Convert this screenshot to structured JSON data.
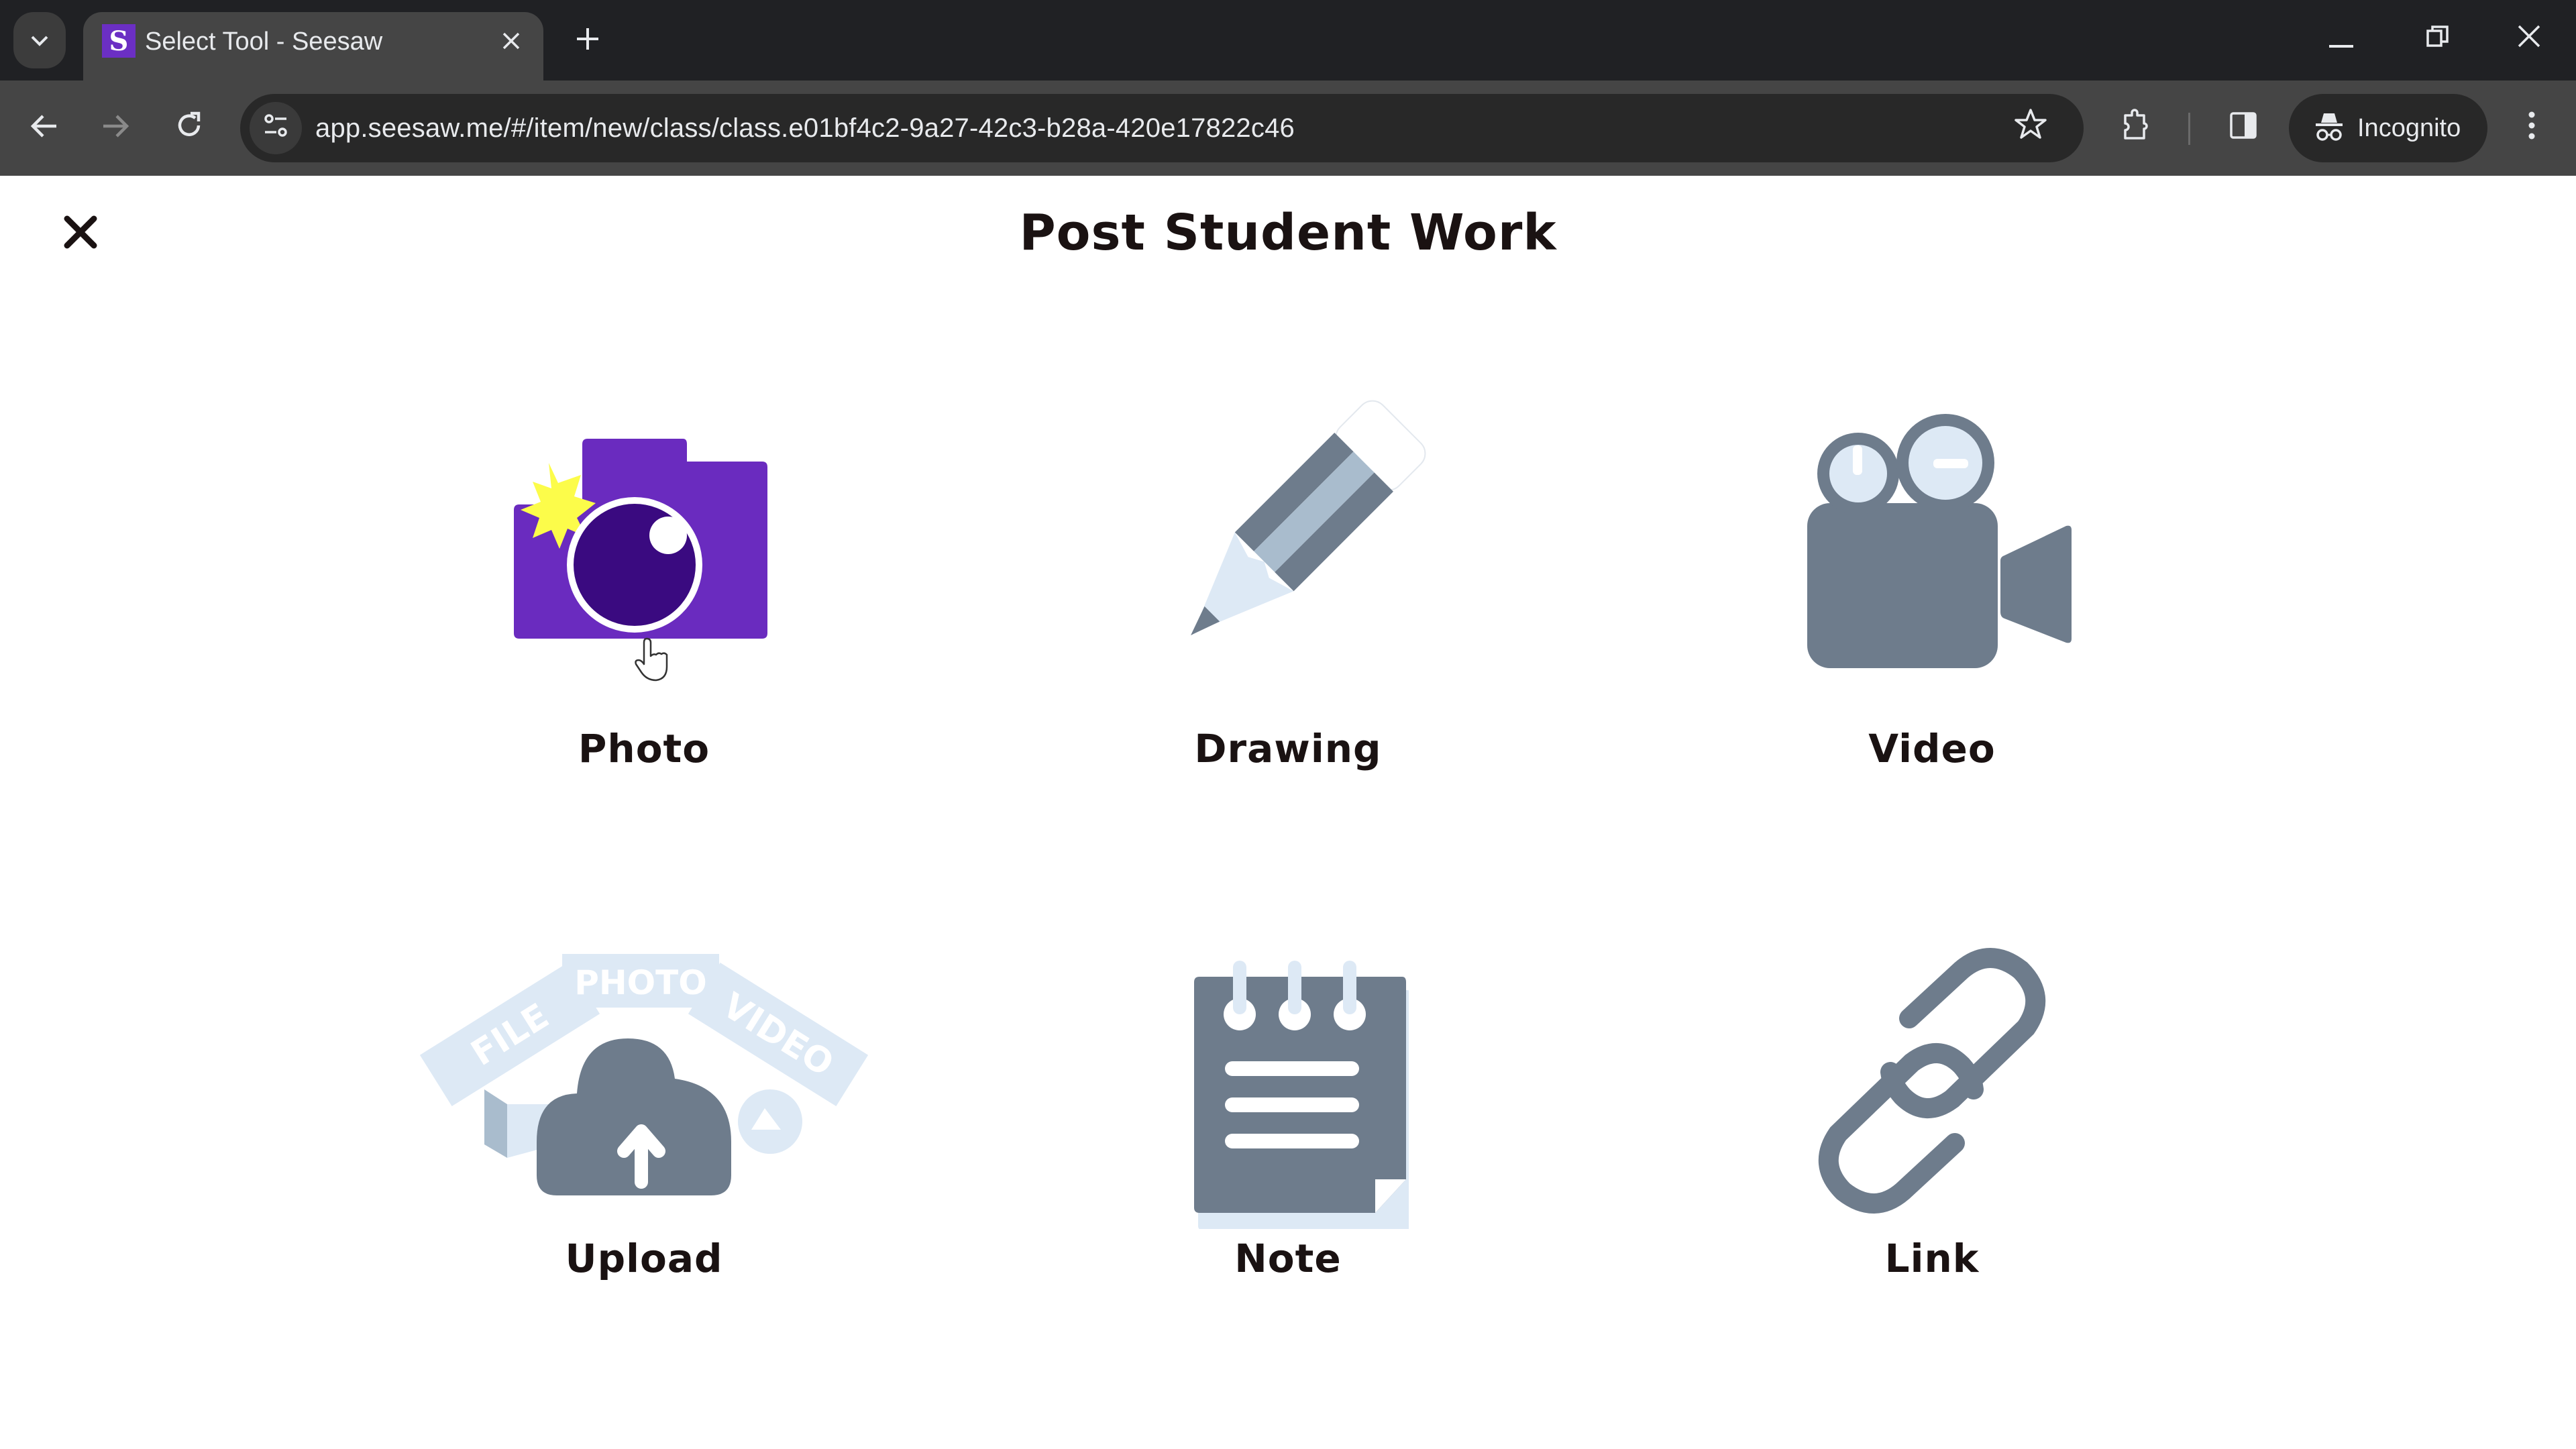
{
  "browser": {
    "tab": {
      "title": "Select Tool - Seesaw",
      "favicon_letter": "S",
      "favicon_color": "#6b2fc4"
    },
    "url": "app.seesaw.me/#/item/new/class/class.e01bf4c2-9a27-42c3-b28a-420e17822c46",
    "incognito_label": "Incognito",
    "icons": {
      "tab_search": "chevron-down-icon",
      "tab_close": "close-icon",
      "new_tab": "plus-icon",
      "minimize": "minimize-icon",
      "restore": "restore-icon",
      "window_close": "close-icon",
      "back": "arrow-left-icon",
      "forward": "arrow-right-icon",
      "reload": "reload-icon",
      "site_info": "tune-icon",
      "bookmark": "star-icon",
      "extensions": "puzzle-icon",
      "side_panel": "side-panel-icon",
      "incognito": "incognito-icon",
      "menu": "kebab-menu-icon"
    }
  },
  "page": {
    "title": "Post Student Work",
    "close_icon": "close-icon",
    "tools": [
      {
        "label": "Photo",
        "icon": "camera-icon",
        "accent": "#6a2bbf"
      },
      {
        "label": "Drawing",
        "icon": "pencil-icon",
        "accent": "#6e7c8c"
      },
      {
        "label": "Video",
        "icon": "video-camera-icon",
        "accent": "#6e7c8c"
      },
      {
        "label": "Upload",
        "icon": "cloud-upload-icon",
        "accent": "#6e7c8c",
        "badges": [
          "FILE",
          "PHOTO",
          "VIDEO"
        ]
      },
      {
        "label": "Note",
        "icon": "notepad-icon",
        "accent": "#6e7c8c"
      },
      {
        "label": "Link",
        "icon": "link-icon",
        "accent": "#6e7c8c"
      }
    ]
  },
  "colors": {
    "primary_purple": "#6a2bbf",
    "lens_dark": "#3a0a80",
    "flash_yellow": "#fcfc4a",
    "slate": "#6e7c8c",
    "slate_light": "#a9bccd",
    "pale_blue": "#dde9f5",
    "text_dark": "#1a1212"
  }
}
